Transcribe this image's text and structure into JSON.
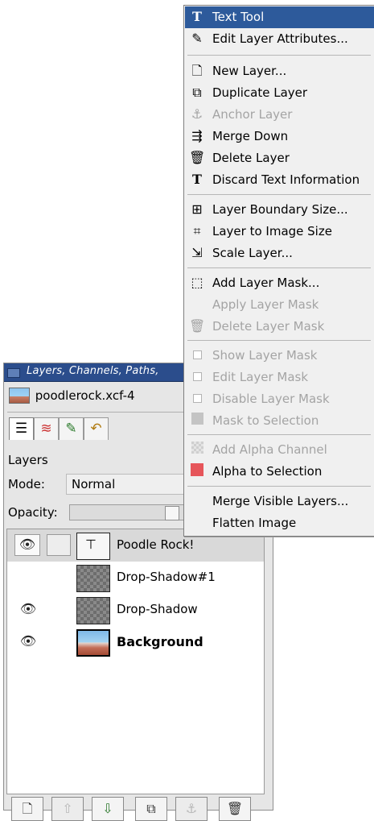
{
  "dock": {
    "title": "Layers, Channels, Paths,",
    "image_name": "poodlerock.xcf-4",
    "tab_icons": [
      "layers-icon",
      "channels-icon",
      "paths-icon",
      "undo-history-icon"
    ],
    "section_label": "Layers",
    "mode_label": "Mode:",
    "mode_value": "Normal",
    "opacity_label": "Opacity:",
    "layers": [
      {
        "name": "Poodle Rock!",
        "visible": true,
        "selected": true,
        "thumb": "text",
        "bold": false,
        "eye": "👁"
      },
      {
        "name": "Drop-Shadow#1",
        "visible": false,
        "selected": false,
        "thumb": "checker",
        "bold": false,
        "eye": ""
      },
      {
        "name": "Drop-Shadow",
        "visible": true,
        "selected": false,
        "thumb": "checker",
        "bold": false,
        "eye": "👁"
      },
      {
        "name": "Background",
        "visible": true,
        "selected": false,
        "thumb": "photo",
        "bold": true,
        "eye": "👁"
      }
    ],
    "footer_buttons": [
      {
        "icon": "new-layer-icon",
        "glyph": "🗋",
        "enabled": true
      },
      {
        "icon": "raise-layer-icon",
        "glyph": "⇧",
        "enabled": false
      },
      {
        "icon": "lower-layer-icon",
        "glyph": "⇩",
        "enabled": true
      },
      {
        "icon": "duplicate-layer-icon",
        "glyph": "⧉",
        "enabled": true
      },
      {
        "icon": "anchor-layer-icon",
        "glyph": "⚓",
        "enabled": false
      },
      {
        "icon": "delete-layer-icon",
        "glyph": "🗑",
        "enabled": true
      }
    ]
  },
  "menu": {
    "items": [
      {
        "label": "Text Tool",
        "icon": "text-tool-icon",
        "glyph": "T",
        "enabled": true,
        "highlighted": true
      },
      {
        "label": "Edit Layer Attributes...",
        "icon": "edit-attributes-icon",
        "glyph": "✎",
        "enabled": true
      },
      {
        "label": "New Layer...",
        "icon": "new-layer-icon",
        "glyph": "🗋",
        "enabled": true
      },
      {
        "label": "Duplicate Layer",
        "icon": "duplicate-layer-icon",
        "glyph": "⧉",
        "enabled": true
      },
      {
        "label": "Anchor Layer",
        "icon": "anchor-icon",
        "glyph": "⚓",
        "enabled": false
      },
      {
        "label": "Merge Down",
        "icon": "merge-down-icon",
        "glyph": "⇶",
        "enabled": true
      },
      {
        "label": "Delete Layer",
        "icon": "delete-layer-icon",
        "glyph": "🗑",
        "enabled": true
      },
      {
        "label": "Discard Text Information",
        "icon": "text-icon",
        "glyph": "T",
        "enabled": true
      },
      {
        "label": "Layer Boundary Size...",
        "icon": "boundary-size-icon",
        "glyph": "⊞",
        "enabled": true
      },
      {
        "label": "Layer to Image Size",
        "icon": "layer-to-image-size-icon",
        "glyph": "⌗",
        "enabled": true
      },
      {
        "label": "Scale Layer...",
        "icon": "scale-layer-icon",
        "glyph": "⇲",
        "enabled": true
      },
      {
        "label": "Add Layer Mask...",
        "icon": "add-mask-icon",
        "glyph": "⬚",
        "enabled": true
      },
      {
        "label": "Apply Layer Mask",
        "icon": "",
        "glyph": "",
        "enabled": false
      },
      {
        "label": "Delete Layer Mask",
        "icon": "delete-mask-icon",
        "glyph": "🗑",
        "enabled": false
      },
      {
        "label": "Show Layer Mask",
        "icon": "checkbox-icon",
        "glyph": "",
        "enabled": false
      },
      {
        "label": "Edit Layer Mask",
        "icon": "checkbox-icon",
        "glyph": "",
        "enabled": false
      },
      {
        "label": "Disable Layer Mask",
        "icon": "checkbox-icon",
        "glyph": "",
        "enabled": false
      },
      {
        "label": "Mask to Selection",
        "icon": "mask-to-selection-icon",
        "glyph": "",
        "enabled": false
      },
      {
        "label": "Add Alpha Channel",
        "icon": "add-alpha-icon",
        "glyph": "",
        "enabled": false
      },
      {
        "label": "Alpha to Selection",
        "icon": "alpha-to-selection-icon",
        "glyph": "",
        "enabled": true
      },
      {
        "label": "Merge Visible Layers...",
        "icon": "",
        "glyph": "",
        "enabled": true
      },
      {
        "label": "Flatten Image",
        "icon": "",
        "glyph": "",
        "enabled": true
      }
    ]
  }
}
